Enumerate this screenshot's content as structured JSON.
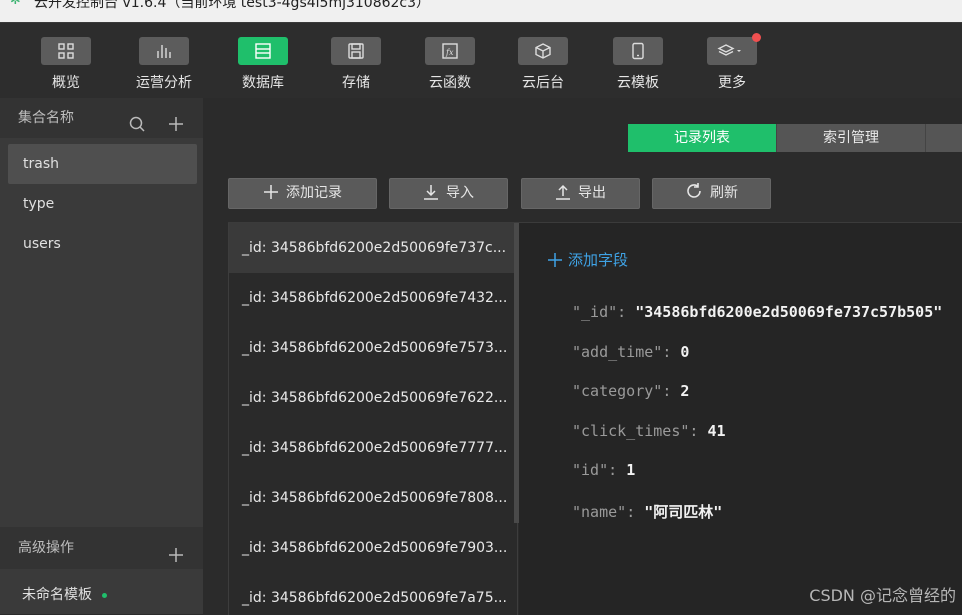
{
  "window": {
    "title": "云开发控制台 v1.6.4（当前环境 test3-4gs4i5mj310862c3）"
  },
  "toolbar": {
    "items": [
      {
        "label": "概览",
        "icon": "grid-icon"
      },
      {
        "label": "运营分析",
        "icon": "bar-chart-icon"
      },
      {
        "label": "数据库",
        "icon": "database-icon",
        "active": true
      },
      {
        "label": "存储",
        "icon": "storage-icon"
      },
      {
        "label": "云函数",
        "icon": "function-icon"
      },
      {
        "label": "云后台",
        "icon": "cube-icon"
      },
      {
        "label": "云模板",
        "icon": "phone-icon"
      },
      {
        "label": "更多",
        "icon": "layers-icon",
        "badge": true
      }
    ]
  },
  "sidebar": {
    "header": "集合名称",
    "collections": [
      "trash",
      "type",
      "users"
    ],
    "selected": "trash",
    "advanced_header": "高级操作",
    "template_name": "未命名模板"
  },
  "tabs": [
    "记录列表",
    "索引管理"
  ],
  "actions": {
    "add": "添加记录",
    "import": "导入",
    "export": "导出",
    "refresh": "刷新"
  },
  "records": [
    "_id: 34586bfd6200e2d50069fe737c...",
    "_id: 34586bfd6200e2d50069fe7432...",
    "_id: 34586bfd6200e2d50069fe7573...",
    "_id: 34586bfd6200e2d50069fe7622...",
    "_id: 34586bfd6200e2d50069fe7777...",
    "_id: 34586bfd6200e2d50069fe7808...",
    "_id: 34586bfd6200e2d50069fe7903...",
    "_id: 34586bfd6200e2d50069fe7a75..."
  ],
  "detail": {
    "add_field": "添加字段",
    "fields": [
      {
        "key": "\"_id\"",
        "value": "\"34586bfd6200e2d50069fe737c57b505\""
      },
      {
        "key": "\"add_time\"",
        "value": "0"
      },
      {
        "key": "\"category\"",
        "value": "2"
      },
      {
        "key": "\"click_times\"",
        "value": "41"
      },
      {
        "key": "\"id\"",
        "value": "1"
      },
      {
        "key": "\"name\"",
        "value": "\"阿司匹林\""
      }
    ]
  },
  "watermark": "CSDN @记念曾经的",
  "colors": {
    "accent": "#1fbf6b",
    "link": "#3fa3e6",
    "badge": "#f05050"
  }
}
